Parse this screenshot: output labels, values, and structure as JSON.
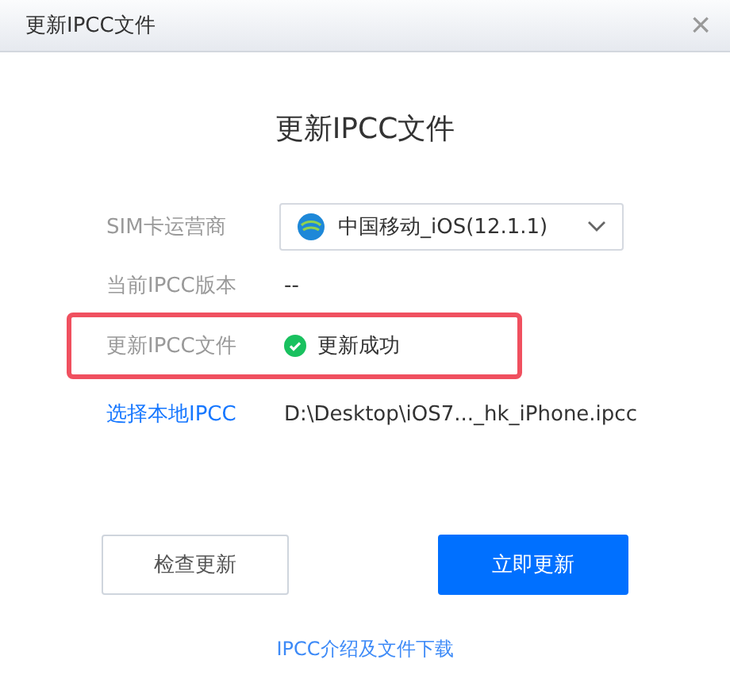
{
  "window": {
    "title": "更新IPCC文件",
    "close": "×"
  },
  "heading": "更新IPCC文件",
  "rows": [
    {
      "kind": "select",
      "label": "SIM卡运营商",
      "value": "中国移动_iOS(12.1.1)",
      "highlighted": false
    },
    {
      "kind": "text",
      "label": "当前IPCC版本",
      "value": "--",
      "highlighted": false
    },
    {
      "kind": "status",
      "label": "更新IPCC文件",
      "value": "更新成功",
      "succeeded": true,
      "highlighted": true
    },
    {
      "kind": "link",
      "label": "选择本地IPCC",
      "value": "D:\\Desktop\\iOS7..._hk_iPhone.ipcc",
      "highlighted": false
    }
  ],
  "buttons": [
    {
      "label": "检查更新",
      "primary": false
    },
    {
      "label": "立即更新",
      "primary": true
    }
  ],
  "footer_link": "IPCC介绍及文件下载"
}
